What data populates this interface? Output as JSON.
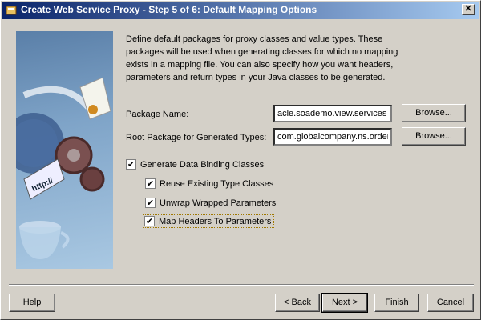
{
  "window": {
    "title": "Create Web Service Proxy - Step 5 of 6: Default Mapping Options",
    "close_label": "✕"
  },
  "description": "Define default packages for proxy classes and value types. These packages will be used when generating classes for which no mapping exists in a mapping file. You can also specify how you want headers, parameters and return types in your Java classes to be generated.",
  "illustration_badge": "http://",
  "package_name": {
    "label": "Package Name:",
    "value": "acle.soademo.view.services",
    "browse_label": "Browse..."
  },
  "root_package": {
    "label": "Root Package for Generated Types:",
    "value": "com.globalcompany.ns.order",
    "browse_label": "Browse..."
  },
  "checkboxes": {
    "generate_binding": {
      "label": "Generate Data Binding Classes",
      "checked": true
    },
    "reuse_types": {
      "label": "Reuse Existing Type Classes",
      "checked": true
    },
    "unwrap_params": {
      "label": "Unwrap Wrapped Parameters",
      "checked": true
    },
    "map_headers": {
      "label": "Map Headers To Parameters",
      "checked": true
    }
  },
  "buttons": {
    "help": "Help",
    "back": "< Back",
    "next": "Next >",
    "finish": "Finish",
    "cancel": "Cancel"
  },
  "colors": {
    "title_start": "#0a246a",
    "title_end": "#a6caf0",
    "dialog_bg": "#d4d0c8"
  }
}
